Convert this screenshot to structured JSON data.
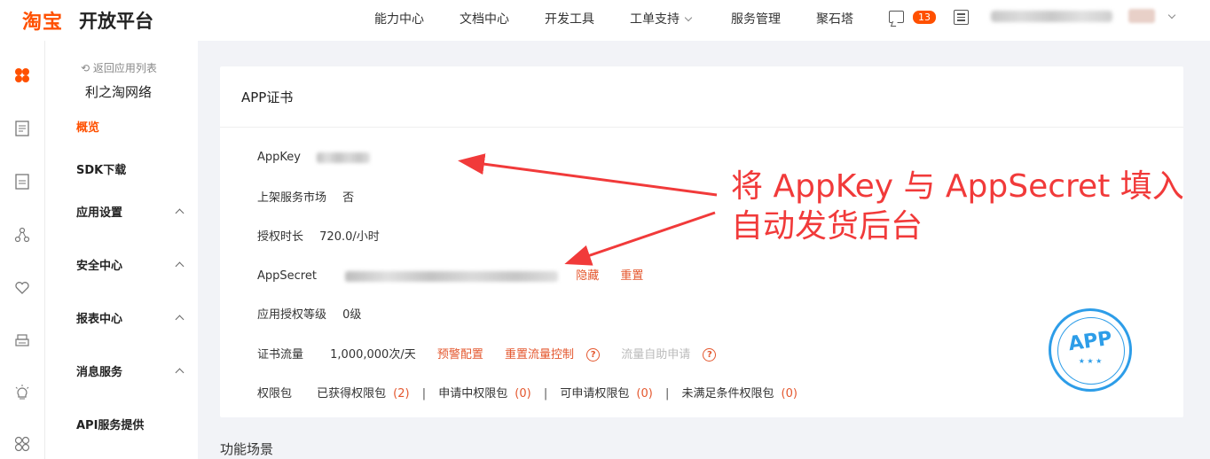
{
  "header": {
    "logo_mark": "淘宝",
    "logo_text": "开放平台",
    "nav": [
      {
        "label": "能力中心"
      },
      {
        "label": "文档中心"
      },
      {
        "label": "开发工具"
      },
      {
        "label": "工单支持"
      },
      {
        "label": "服务管理"
      },
      {
        "label": "聚石塔"
      }
    ],
    "message_count": "13"
  },
  "sidebar": {
    "back_label": "返回应用列表",
    "app_name": "利之淘网络",
    "items": [
      {
        "label": "概览"
      },
      {
        "label": "SDK下载"
      },
      {
        "label": "应用设置"
      },
      {
        "label": "安全中心"
      },
      {
        "label": "报表中心"
      },
      {
        "label": "消息服务"
      },
      {
        "label": "API服务提供"
      }
    ]
  },
  "card": {
    "title": "APP证书",
    "appkey_label": "AppKey",
    "market_label": "上架服务市场",
    "market_value": "否",
    "duration_label": "授权时长",
    "duration_value": "720.0/小时",
    "secret_label": "AppSecret",
    "hide_label": "隐藏",
    "reset_label": "重置",
    "level_label": "应用授权等级",
    "level_value": "0级",
    "traffic_label": "证书流量",
    "traffic_value": "1,000,000次/天",
    "alert_config": "预警配置",
    "reset_traffic": "重置流量控制",
    "self_apply": "流量自助申请",
    "perm_label": "权限包",
    "perm_obtained": "已获得权限包",
    "perm_obtained_count": "(2)",
    "perm_applying": "申请中权限包",
    "perm_applying_count": "(0)",
    "perm_available": "可申请权限包",
    "perm_available_count": "(0)",
    "perm_unmet": "未满足条件权限包",
    "perm_unmet_count": "(0)"
  },
  "next_section": "功能场景",
  "annotation": {
    "line1": "将 AppKey 与 AppSecret 填入",
    "line2": "自动发货后台"
  },
  "stamp": {
    "text": "APP"
  },
  "colors": {
    "brand": "#ff5000",
    "link": "#e4572e",
    "annotation": "#f13a3a",
    "stamp": "#2d9de8"
  }
}
